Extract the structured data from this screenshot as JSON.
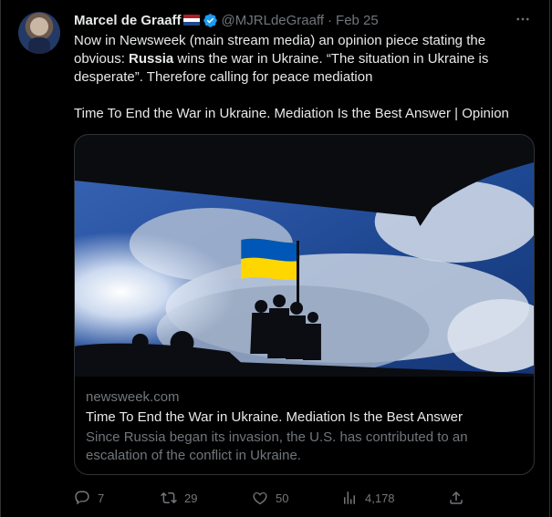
{
  "author": {
    "name": "Marcel de Graaff",
    "handle": "@MJRLdeGraaff",
    "separator": "·",
    "date": "Feb 25"
  },
  "tweet": {
    "line1_prefix": "Now in Newsweek (main stream media) an opinion piece stating the obvious: ",
    "line1_bold": "Russia",
    "line1_suffix": " wins the war in Ukraine. “The situation in Ukraine is desperate”. Therefore calling for peace mediation",
    "line2": "Time To End the War in Ukraine. Mediation Is the Best Answer | Opinion"
  },
  "card": {
    "domain": "newsweek.com",
    "title": "Time To End the War in Ukraine. Mediation Is the Best Answer",
    "description": "Since Russia began its invasion, the U.S. has contributed to an escalation of the conflict in Ukraine."
  },
  "actions": {
    "replies": "7",
    "retweets": "29",
    "likes": "50",
    "views": "4,178"
  },
  "icons": {
    "verified": "verified-badge-icon",
    "flag": "netherlands-flag-icon",
    "more": "more-options-icon",
    "reply": "reply-icon",
    "retweet": "retweet-icon",
    "like": "heart-icon",
    "views": "views-icon",
    "share": "share-icon"
  },
  "colors": {
    "background": "#000000",
    "text": "#e7e9ea",
    "muted": "#71767b",
    "border": "#2f3336",
    "verified": "#1d9bf0",
    "flag_blue": "#0057b7",
    "flag_yellow": "#ffd700"
  }
}
